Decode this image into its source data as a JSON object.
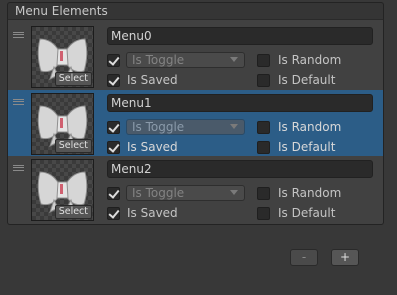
{
  "list": {
    "title": "Menu Elements",
    "items": [
      {
        "name": "Menu0",
        "selected": false,
        "is_toggle_label": "Is Toggle",
        "is_saved_label": "Is Saved",
        "is_random_label": "Is Random",
        "is_default_label": "Is Default",
        "select_label": "Select",
        "enabled_checked": true,
        "is_saved_checked": true,
        "is_random_checked": false,
        "is_default_checked": false
      },
      {
        "name": "Menu1",
        "selected": true,
        "is_toggle_label": "Is Toggle",
        "is_saved_label": "Is Saved",
        "is_random_label": "Is Random",
        "is_default_label": "Is Default",
        "select_label": "Select",
        "enabled_checked": true,
        "is_saved_checked": true,
        "is_random_checked": false,
        "is_default_checked": false
      },
      {
        "name": "Menu2",
        "selected": false,
        "is_toggle_label": "Is Toggle",
        "is_saved_label": "Is Saved",
        "is_random_label": "Is Random",
        "is_default_label": "Is Default",
        "select_label": "Select",
        "enabled_checked": true,
        "is_saved_checked": true,
        "is_random_checked": false,
        "is_default_checked": false
      }
    ]
  },
  "footer": {
    "remove_label": "-",
    "add_label": "+"
  },
  "colors": {
    "selection": "#2c5d87",
    "panel": "#383838",
    "field": "#2a2a2a"
  },
  "icons": {
    "thumbnail": "bowtie-icon",
    "handle": "drag-handle-icon"
  }
}
